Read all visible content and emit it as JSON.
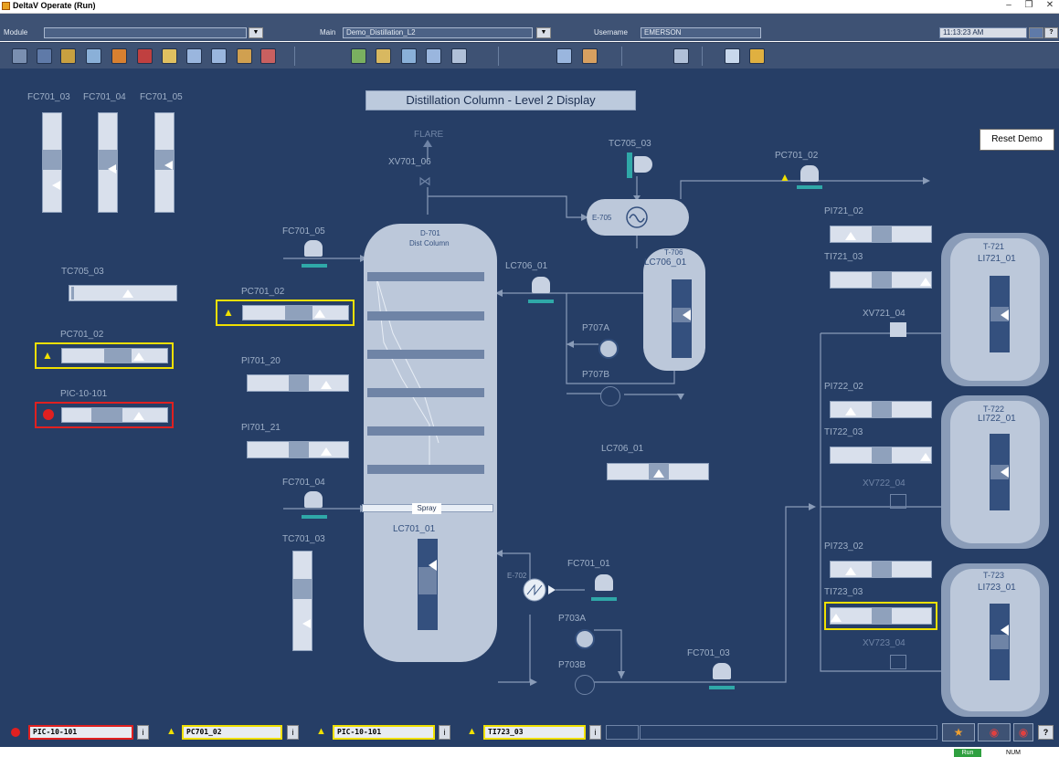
{
  "window": {
    "title": "DeltaV Operate (Run)"
  },
  "header": {
    "module_label": "Module",
    "module_value": "",
    "main_label": "Main",
    "main_value": "Demo_Distillation_L2",
    "username_label": "Username",
    "username_value": "EMERSON",
    "clock": "11:13:23 AM"
  },
  "display": {
    "title": "Distillation Column - Level 2 Display",
    "reset_button": "Reset Demo"
  },
  "tags": {
    "fc701_03_top": "FC701_03",
    "fc701_04_top": "FC701_04",
    "fc701_05_top": "FC701_05",
    "tc705_03_left": "TC705_03",
    "pc701_02_left": "PC701_02",
    "pic_10_101": "PIC-10-101",
    "fc701_05": "FC701_05",
    "pc701_02_mid": "PC701_02",
    "pi701_20": "PI701_20",
    "pi701_21": "PI701_21",
    "fc701_04": "FC701_04",
    "tc701_03": "TC701_03",
    "flare": "FLARE",
    "xv701_06": "XV701_06",
    "d701_id": "D-701",
    "d701_name": "Dist Column",
    "spray": "Spray",
    "lc701_01": "LC701_01",
    "tc705_03": "TC705_03",
    "e705": "E-705",
    "lc706_01_valve": "LC706_01",
    "t706": "T-706",
    "lc706_01_tank": "LC706_01",
    "p707a": "P707A",
    "p707b": "P707B",
    "lc706_01_bar": "LC706_01",
    "e702": "E-702",
    "fc701_01": "FC701_01",
    "p703a": "P703A",
    "p703b": "P703B",
    "fc701_03": "FC701_03",
    "pc701_02_right": "PC701_02",
    "pi721_02": "PI721_02",
    "ti721_03": "TI721_03",
    "xv721_04": "XV721_04",
    "pi722_02": "PI722_02",
    "ti722_03": "TI722_03",
    "xv722_04": "XV722_04",
    "pi723_02": "PI723_02",
    "ti723_03": "TI723_03",
    "xv723_04": "XV723_04",
    "t721": "T-721",
    "li721_01": "LI721_01",
    "t722": "T-722",
    "li722_01": "LI722_01",
    "t723": "T-723",
    "li723_01": "LI723_01"
  },
  "alarms": [
    {
      "tag": "PIC-10-101",
      "severity": "critical",
      "info": "i"
    },
    {
      "tag": "PC701_02",
      "severity": "warning",
      "info": "i"
    },
    {
      "tag": "PIC-10-101",
      "severity": "warning",
      "info": "i"
    },
    {
      "tag": "TI723_03",
      "severity": "warning",
      "info": "i"
    }
  ],
  "statusbar": {
    "run": "Run",
    "num": "NUM"
  },
  "icons": [
    "app-icon",
    "minimize-icon",
    "restore-icon",
    "close-icon",
    "dropdown-icon",
    "help-icon",
    "warning-icon",
    "alarm-icon",
    "pump-icon",
    "valve-icon",
    "heat-exchanger-icon"
  ],
  "colors": {
    "background": "#263e66",
    "vessel": "#bcc8da",
    "warning": "#f0e000",
    "critical": "#e02020",
    "teal": "#2fa8a8"
  }
}
